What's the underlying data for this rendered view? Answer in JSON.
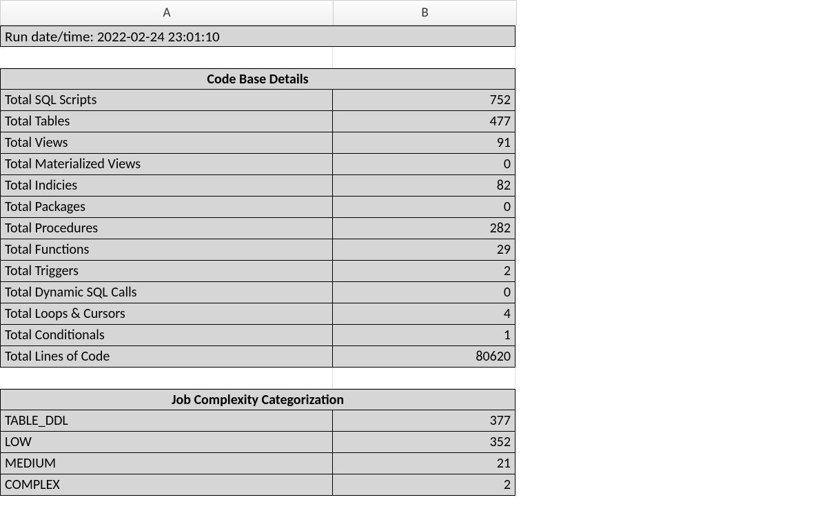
{
  "columns": {
    "a": "A",
    "b": "B"
  },
  "run_date": "Run date/time: 2022-02-24 23:01:10",
  "section1_title": "Code Base Details",
  "code_base": [
    {
      "label": "Total SQL Scripts",
      "value": "752"
    },
    {
      "label": "Total Tables",
      "value": "477"
    },
    {
      "label": "Total Views",
      "value": "91"
    },
    {
      "label": "Total Materialized Views",
      "value": "0"
    },
    {
      "label": "Total Indicies",
      "value": "82"
    },
    {
      "label": "Total Packages",
      "value": "0"
    },
    {
      "label": "Total Procedures",
      "value": "282"
    },
    {
      "label": "Total Functions",
      "value": "29"
    },
    {
      "label": "Total Triggers",
      "value": "2"
    },
    {
      "label": "Total Dynamic SQL Calls",
      "value": "0"
    },
    {
      "label": "Total Loops & Cursors",
      "value": "4"
    },
    {
      "label": "Total Conditionals",
      "value": "1"
    },
    {
      "label": "Total Lines of Code",
      "value": "80620"
    }
  ],
  "section2_title": "Job Complexity Categorization",
  "complexity": [
    {
      "label": "TABLE_DDL",
      "value": "377"
    },
    {
      "label": "LOW",
      "value": "352"
    },
    {
      "label": "MEDIUM",
      "value": "21"
    },
    {
      "label": "COMPLEX",
      "value": "2"
    }
  ],
  "chart_data": [
    {
      "type": "table",
      "title": "Code Base Details",
      "categories": [
        "Total SQL Scripts",
        "Total Tables",
        "Total Views",
        "Total Materialized Views",
        "Total Indicies",
        "Total Packages",
        "Total Procedures",
        "Total Functions",
        "Total Triggers",
        "Total Dynamic SQL Calls",
        "Total Loops & Cursors",
        "Total Conditionals",
        "Total Lines of Code"
      ],
      "values": [
        752,
        477,
        91,
        0,
        82,
        0,
        282,
        29,
        2,
        0,
        4,
        1,
        80620
      ]
    },
    {
      "type": "table",
      "title": "Job Complexity Categorization",
      "categories": [
        "TABLE_DDL",
        "LOW",
        "MEDIUM",
        "COMPLEX"
      ],
      "values": [
        377,
        352,
        21,
        2
      ]
    }
  ]
}
